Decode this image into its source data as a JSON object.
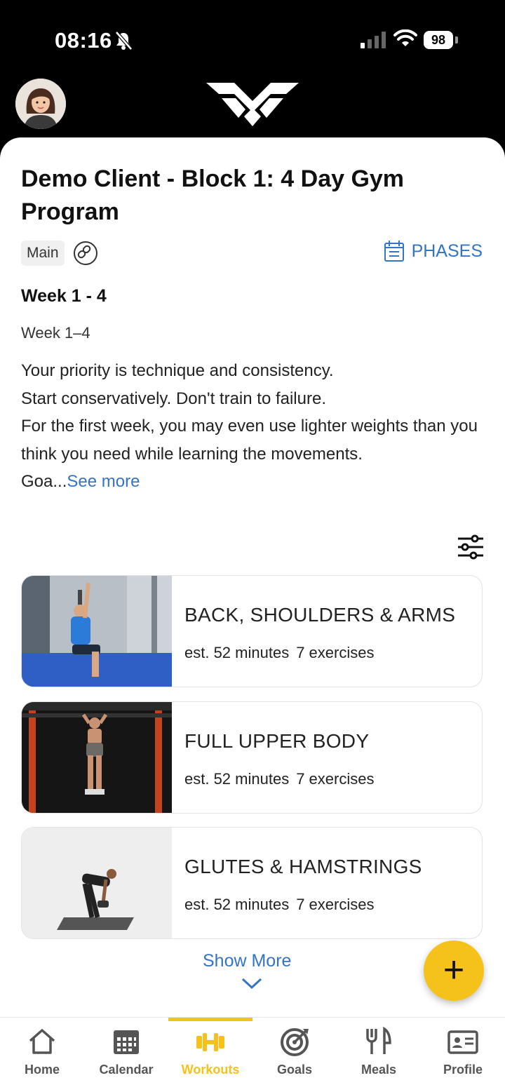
{
  "status_bar": {
    "time": "08:16",
    "battery": "98"
  },
  "program": {
    "title": "Demo Client - Block 1: 4 Day Gym Program",
    "tag": "Main",
    "phases_label": "PHASES",
    "week_heading": "Week 1 - 4",
    "week_sub": "Week 1–4",
    "description_lines": [
      "Your priority is technique and consistency.",
      "Start conservatively. Don't train to failure.",
      "For the first week, you may even use lighter weights than you think you need while learning the movements.",
      "Goa..."
    ],
    "see_more": "See more"
  },
  "workouts": [
    {
      "title": "BACK, SHOULDERS & ARMS",
      "duration": "est. 52 minutes",
      "exercises": "7 exercises"
    },
    {
      "title": "FULL UPPER BODY",
      "duration": "est. 52 minutes",
      "exercises": "7 exercises"
    },
    {
      "title": "GLUTES & HAMSTRINGS",
      "duration": "est. 52 minutes",
      "exercises": "7 exercises"
    }
  ],
  "show_more": "Show More",
  "fab_label": "+",
  "tabs": [
    {
      "label": "Home",
      "icon": "home-icon"
    },
    {
      "label": "Calendar",
      "icon": "calendar-icon"
    },
    {
      "label": "Workouts",
      "icon": "dumbbell-icon",
      "active": true
    },
    {
      "label": "Goals",
      "icon": "target-icon"
    },
    {
      "label": "Meals",
      "icon": "fork-knife-icon"
    },
    {
      "label": "Profile",
      "icon": "id-card-icon"
    }
  ],
  "colors": {
    "accent": "#f5c21b",
    "link": "#3474c5",
    "header_bg": "#000000"
  }
}
